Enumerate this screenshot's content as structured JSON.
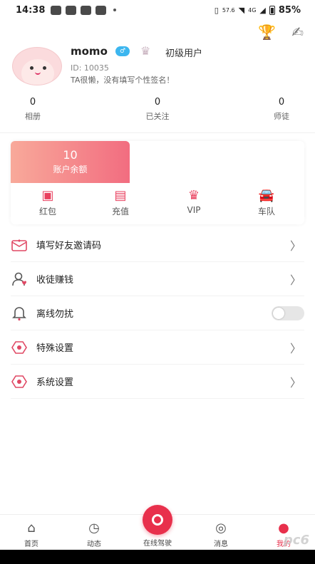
{
  "status_bar": {
    "time": "14:38",
    "net_speed": "57.6",
    "signal": "4G",
    "battery": "85%"
  },
  "profile": {
    "username": "momo",
    "badge": "♂",
    "level": "初级用户",
    "id": "ID: 10035",
    "bio": "TA很懒，没有填写个性签名！"
  },
  "stats": [
    {
      "value": "0",
      "label": "相册"
    },
    {
      "value": "0",
      "label": "已关注"
    },
    {
      "value": "0",
      "label": "师徒"
    }
  ],
  "wallet": {
    "balance": "10",
    "balance_label": "账户余额",
    "items": [
      {
        "label": "红包",
        "icon": "red-packet-icon"
      },
      {
        "label": "充值",
        "icon": "wallet-icon"
      },
      {
        "label": "VIP",
        "icon": "crown-icon"
      },
      {
        "label": "车队",
        "icon": "car-icon"
      }
    ]
  },
  "settings": [
    {
      "label": "填写好友邀请码",
      "icon": "envelope-icon",
      "control": "chevron"
    },
    {
      "label": "收徒赚钱",
      "icon": "user-heart-icon",
      "control": "chevron"
    },
    {
      "label": "离线勿扰",
      "icon": "bell-icon",
      "control": "toggle",
      "toggle_on": false
    },
    {
      "label": "特殊设置",
      "icon": "gear-icon",
      "control": "chevron"
    },
    {
      "label": "系统设置",
      "icon": "gear-icon",
      "control": "chevron"
    }
  ],
  "bottom_nav": [
    {
      "label": "首页",
      "icon": "home-icon"
    },
    {
      "label": "动态",
      "icon": "clock-icon"
    },
    {
      "label": "在线驾驶",
      "icon": "drive-icon"
    },
    {
      "label": "消息",
      "icon": "message-icon"
    },
    {
      "label": "我的",
      "icon": "profile-icon",
      "active": true
    }
  ],
  "watermark": "pc6",
  "colors": {
    "accent": "#e8304c",
    "balance_gradient_start": "#f8a99a",
    "balance_gradient_end": "#f26d80"
  }
}
